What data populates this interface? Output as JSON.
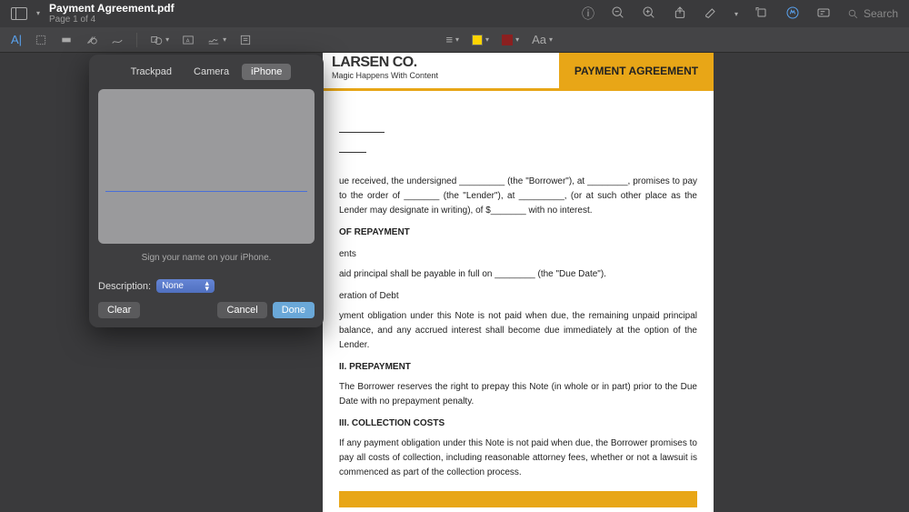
{
  "header": {
    "filename": "Payment Agreement.pdf",
    "page_info": "Page 1 of 4",
    "search_placeholder": "Search"
  },
  "signature_panel": {
    "tabs": {
      "trackpad": "Trackpad",
      "camera": "Camera",
      "iphone": "iPhone"
    },
    "hint": "Sign your name on your iPhone.",
    "description_label": "Description:",
    "description_value": "None",
    "buttons": {
      "clear": "Clear",
      "cancel": "Cancel",
      "done": "Done"
    }
  },
  "document": {
    "company": "LARSEN CO.",
    "tagline": "Magic Happens With Content",
    "title": "PAYMENT AGREEMENT",
    "intro": "ue received, the undersigned _________ (the \"Borrower\"), at ________, promises to pay to the order of _______ (the \"Lender\"), at _________, (or at such other place as the Lender may designate in writing), of $_______ with no interest.",
    "section1_head": "OF REPAYMENT",
    "sub1a": "ents",
    "sub1a_text": "aid principal shall be payable in full on ________ (the \"Due Date\").",
    "sub1b": "eration of Debt",
    "sub1b_text": "yment obligation under this Note is not paid when due, the remaining unpaid principal balance, and any accrued interest shall become due immediately at the option of the Lender.",
    "section2_head": "II. PREPAYMENT",
    "section2_text": "The Borrower reserves the right to prepay this Note (in whole or in part) prior to the Due Date with no prepayment penalty.",
    "section3_head": "III. COLLECTION COSTS",
    "section3_text": "If any payment obligation under this Note is not paid when due, the Borrower promises to pay all costs of collection, including reasonable attorney fees, whether or not a lawsuit is commenced as part of the collection process."
  }
}
